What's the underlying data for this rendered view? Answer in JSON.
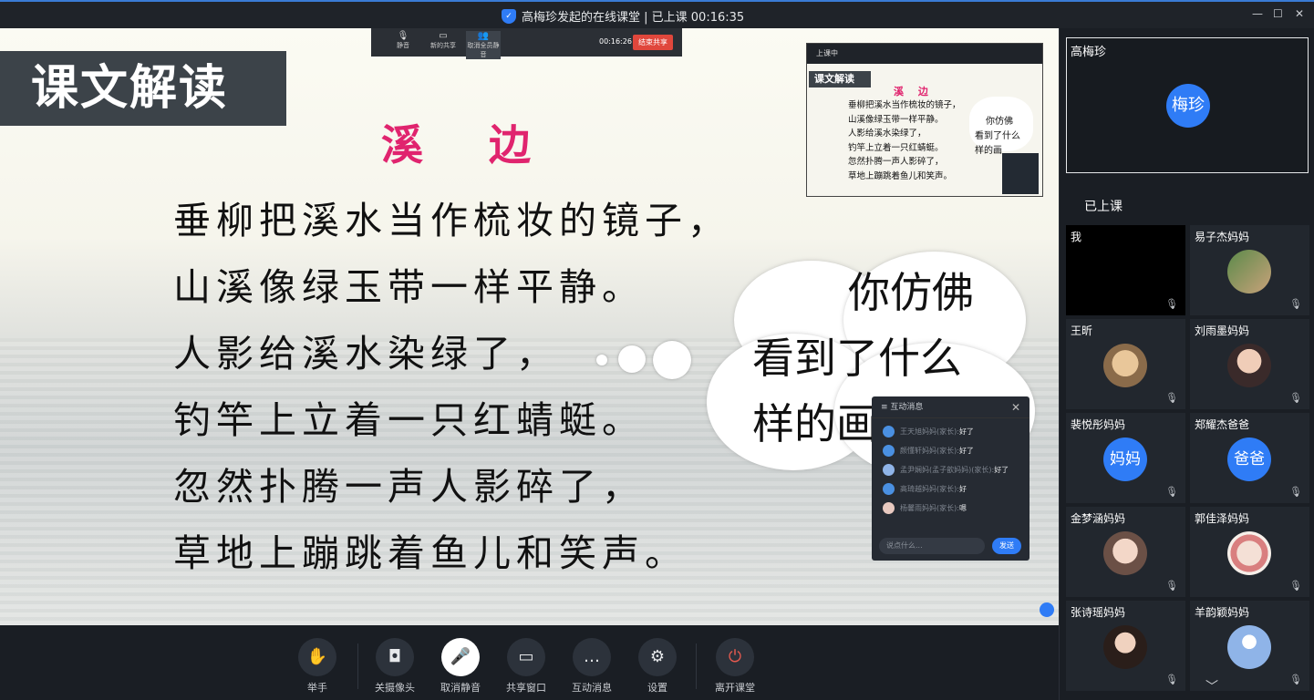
{
  "window": {
    "title": "高梅珍发起的在线课堂 | 已上课 00:16:35",
    "minimize": "—",
    "maximize": "☐",
    "close": "✕"
  },
  "slide": {
    "section_label": "课文解读",
    "poem_title": "溪 边",
    "poem_lines": [
      "垂柳把溪水当作梳妆的镜子，",
      "山溪像绿玉带一样平静。",
      "人影给溪水染绿了，",
      "钓竿上立着一只红蜻蜓。",
      "忽然扑腾一声人影碎了，",
      "草地上蹦跳着鱼儿和笑声。"
    ],
    "cloud_lines": [
      "你仿佛",
      "看到了什么",
      "样的画"
    ]
  },
  "share_bar": {
    "items": [
      "静音",
      "新的共享",
      "取消全员静音"
    ],
    "timer": "00:16:26",
    "end_label": "结束共享"
  },
  "preview": {
    "header": "上课中",
    "label": "课文解读",
    "title": "溪 边",
    "lines": [
      "垂柳把溪水当作梳妆的镜子，",
      "山溪像绿玉带一样平静。",
      "人影给溪水染绿了，",
      "钓竿上立着一只红蜻蜓。",
      "忽然扑腾一声人影碎了，",
      "草地上蹦跳着鱼儿和笑声。"
    ],
    "cloud_lines": [
      "你仿佛",
      "看到了什么",
      "样的画"
    ]
  },
  "chat": {
    "title": "互动消息",
    "messages": [
      {
        "sender": "王天旭妈妈(家长):",
        "text": "好了"
      },
      {
        "sender": "颜懂轩妈妈(家长):",
        "text": "好了"
      },
      {
        "sender": "孟尹娴妈(孟子歆妈妈)(家长):",
        "text": "好了"
      },
      {
        "sender": "高琦越妈妈(家长):",
        "text": "好"
      },
      {
        "sender": "杨馨雨妈妈(家长):",
        "text": "嗯"
      }
    ],
    "input_placeholder": "说点什么...",
    "send_label": "发送"
  },
  "toolbar": {
    "buttons": [
      {
        "label": "举手",
        "icon": "✋"
      },
      {
        "label": "关摄像头",
        "icon": "◘"
      },
      {
        "label": "取消静音",
        "icon": "🎤"
      },
      {
        "label": "共享窗口",
        "icon": "▭"
      },
      {
        "label": "互动消息",
        "icon": "…"
      },
      {
        "label": "设置",
        "icon": "⚙"
      },
      {
        "label": "离开课堂",
        "icon": "⏻"
      }
    ]
  },
  "sidebar": {
    "host": {
      "name": "高梅珍",
      "avatar_text": "梅珍"
    },
    "section_title": "已上课",
    "participants": [
      {
        "name": "我",
        "avatar_text": ""
      },
      {
        "name": "易子杰妈妈",
        "avatar_text": ""
      },
      {
        "name": "王昕",
        "avatar_text": ""
      },
      {
        "name": "刘雨墨妈妈",
        "avatar_text": ""
      },
      {
        "name": "裴悦彤妈妈",
        "avatar_text": "妈妈"
      },
      {
        "name": "郑耀杰爸爸",
        "avatar_text": "爸爸"
      },
      {
        "name": "金梦涵妈妈",
        "avatar_text": ""
      },
      {
        "name": "郭佳泽妈妈",
        "avatar_text": ""
      },
      {
        "name": "张诗瑶妈妈",
        "avatar_text": ""
      },
      {
        "name": "羊韵颖妈妈",
        "avatar_text": ""
      }
    ],
    "mic_icon": "🎙"
  },
  "colors": {
    "accent": "#2f7cf6",
    "title_pink": "#e0246e",
    "leave_red": "#e85a4f"
  }
}
